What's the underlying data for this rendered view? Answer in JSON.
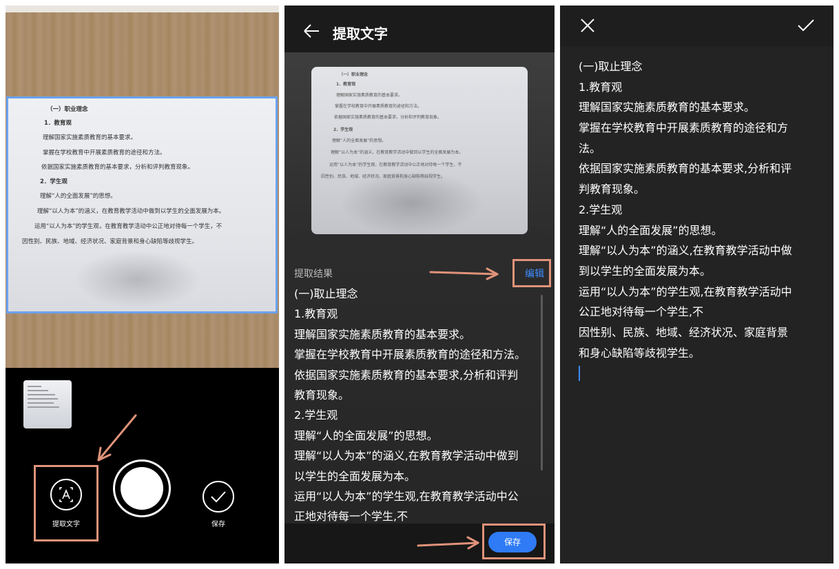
{
  "camera": {
    "document_lines": [
      "（一）职业理念",
      "1．教育观",
      "理解国家实施素质教育的基本要求。",
      "掌握在学校教育中开展素质教育的途径和方法。",
      "依据国家实施素质教育的基本要求，分析和评判教育现象。",
      "2．学生观",
      "理解“人的全面发展”的思想。",
      "理解“以人为本”的涵义，在教育教学活动中做到以学生的全面发展为本。",
      "运用“以人为本”的学生观，在教育教学活动中公正地对待每一个学生，不",
      "因性别、民族、地域、经济状况、家庭背景和身心缺陷等歧视学生。"
    ],
    "extract_label": "提取文字",
    "save_label": "保存",
    "extract_icon": "text-recognition-icon",
    "shutter_icon": "shutter-icon",
    "save_icon": "check-circle-icon"
  },
  "extract": {
    "title": "提取文字",
    "back_icon": "back-arrow-icon",
    "result_label": "提取结果",
    "edit_label": "编辑",
    "save_button": "保存",
    "result_lines": [
      "(一)取止理念",
      "1.教育观",
      "理解国家实施素质教育的基本要求。",
      "掌握在学校教育中开展素质教育的途径和方法。",
      "依据国家实施素质教育的基本要求,分析和评判",
      "教育现象。",
      "2.学生观",
      "理解“人的全面发展”的思想。",
      "理解“以人为本”的涵义,在教育教学活动中做到",
      "以学生的全面发展为本。",
      "运用“以人为本”的学生观,在教育教学活动中公",
      "正地对待每一个学生,不"
    ]
  },
  "edit": {
    "close_icon": "close-icon",
    "confirm_icon": "checkmark-icon",
    "lines": [
      "(一)取止理念",
      "1.教育观",
      "理解国家实施素质教育的基本要求。",
      "掌握在学校教育中开展素质教育的途径和方",
      "法。",
      "依据国家实施素质教育的基本要求,分析和评",
      "判教育现象。",
      "2.学生观",
      "理解“人的全面发展”的思想。",
      "理解“以人为本”的涵义,在教育教学活动中做",
      "到以学生的全面发展为本。",
      "运用“以人为本”的学生观,在教育教学活动中",
      "公正地对待每一个学生,不",
      "因性别、民族、地域、经济状况、家庭背景",
      "和身心缺陷等歧视学生。"
    ]
  },
  "colors": {
    "accent_blue": "#2f7bf5",
    "highlight_orange": "#e0937a",
    "frame_blue": "#6aa3f0"
  }
}
